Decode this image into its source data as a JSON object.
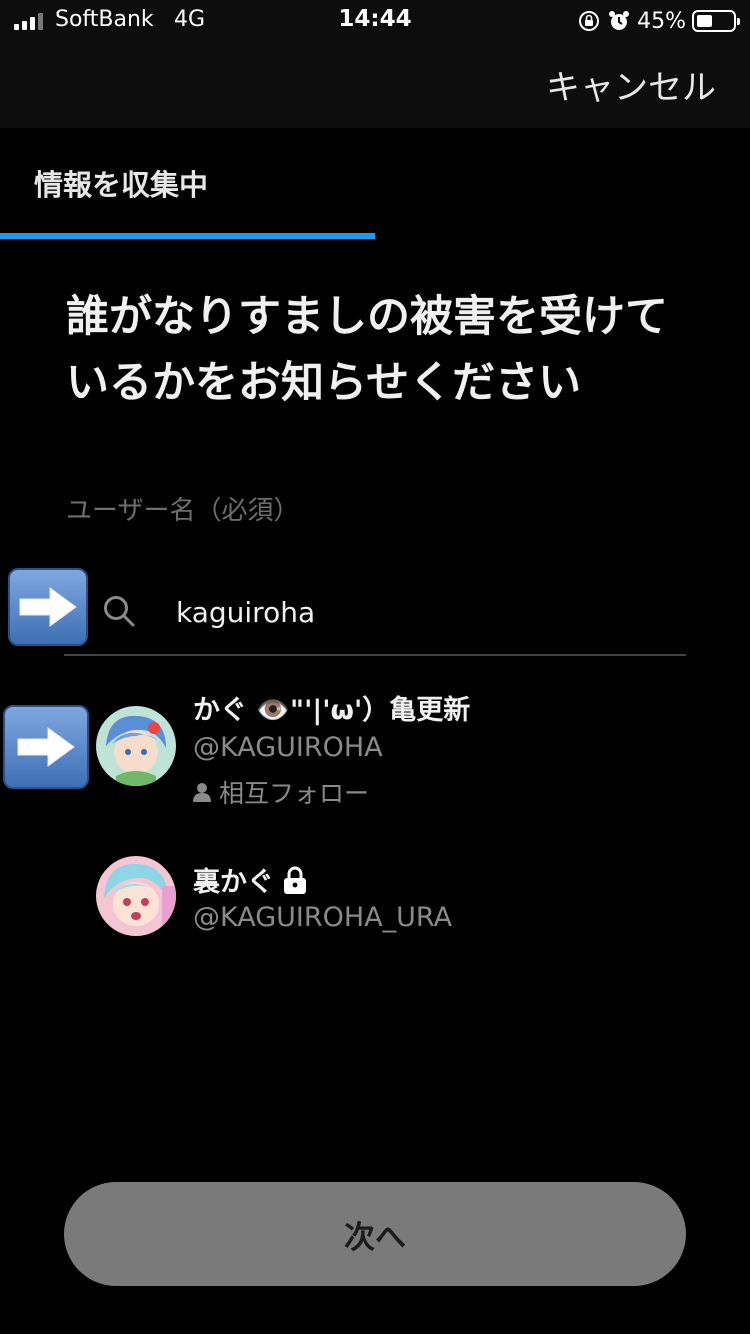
{
  "status_bar": {
    "carrier": "SoftBank",
    "network": "4G",
    "time": "14:44",
    "battery_percent": "45%",
    "battery_level": 0.45,
    "icons": [
      "signal-icon",
      "orientation-lock-icon",
      "alarm-icon",
      "battery-icon"
    ]
  },
  "header": {
    "cancel_label": "キャンセル"
  },
  "flow": {
    "step_title": "情報を収集中",
    "progress_fraction": 0.5,
    "accent_color": "#1d9bf0"
  },
  "main": {
    "heading": "誰がなりすましの被害を受けているかをお知らせください",
    "field_label": "ユーザー名（必須）",
    "search": {
      "value": "kaguiroha",
      "icon": "search-icon"
    }
  },
  "results": [
    {
      "name": "かぐ 👁️\"'|'ω'）亀更新",
      "handle": "@KAGUIROHA",
      "relationship": "相互フォロー",
      "relationship_icon": "person-icon"
    },
    {
      "name": "裏かぐ",
      "handle": "@KAGUIROHA_URA",
      "name_icon": "lock-icon"
    }
  ],
  "annotations": {
    "arrow_icon": "right-arrow-emoji-icon"
  },
  "footer": {
    "next_label": "次へ"
  }
}
